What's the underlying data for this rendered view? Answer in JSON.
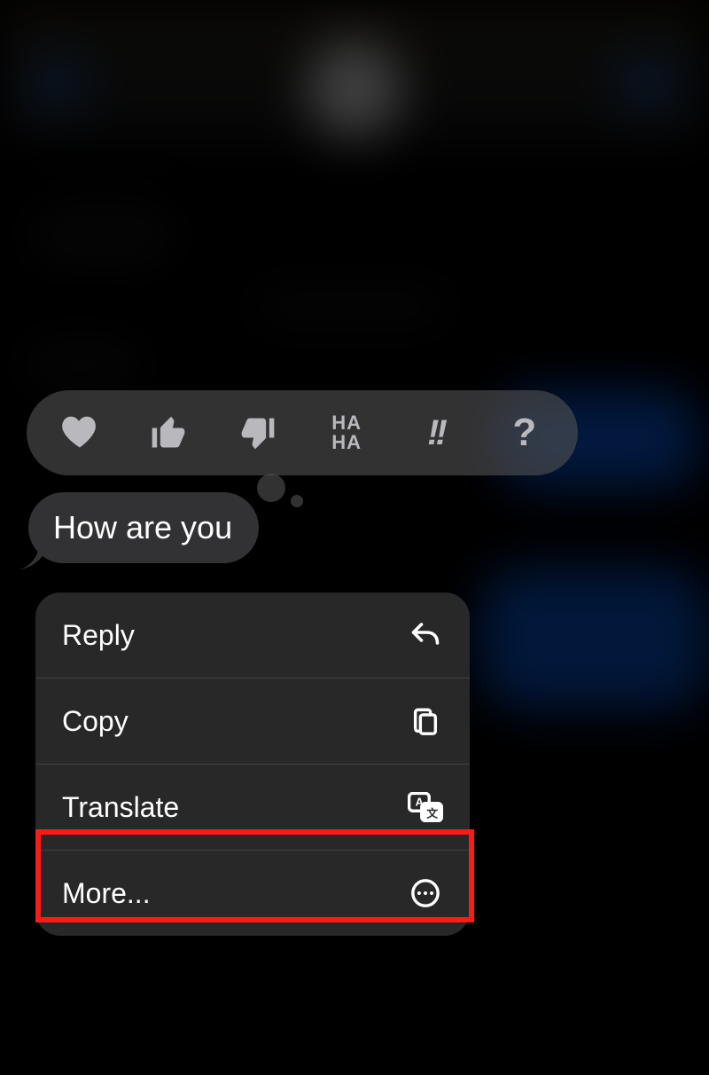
{
  "message": {
    "text": "How are you"
  },
  "tapback": {
    "options": [
      "heart",
      "thumbs-up",
      "thumbs-down",
      "haha",
      "exclamation",
      "question"
    ]
  },
  "menu": {
    "items": [
      {
        "id": "reply",
        "label": "Reply",
        "icon": "reply-icon"
      },
      {
        "id": "copy",
        "label": "Copy",
        "icon": "copy-icon"
      },
      {
        "id": "translate",
        "label": "Translate",
        "icon": "translate-icon"
      },
      {
        "id": "more",
        "label": "More...",
        "icon": "more-icon"
      }
    ]
  },
  "annotation": {
    "highlighted_menu_item": "more",
    "color": "#ff1a1a"
  }
}
